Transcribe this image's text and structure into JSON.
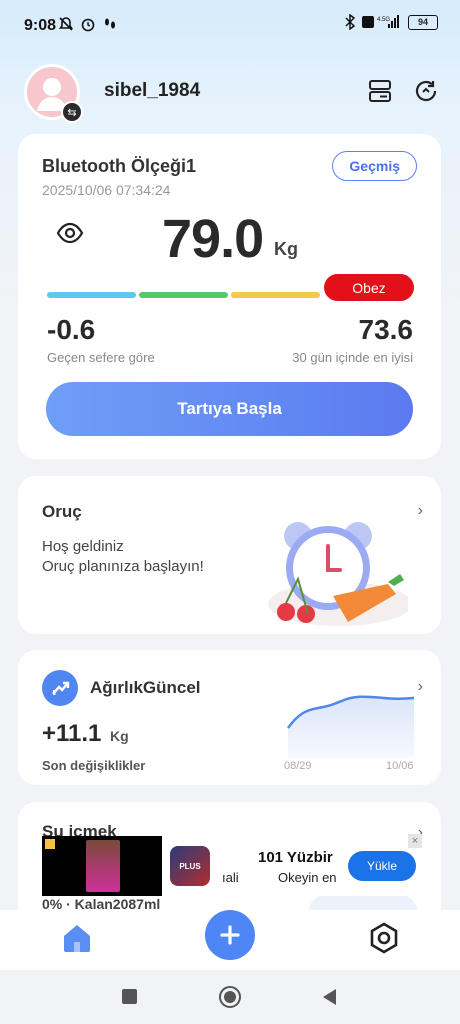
{
  "status_bar": {
    "time": "9:08",
    "battery": "94",
    "network": "4.5G"
  },
  "profile": {
    "username": "sibel_1984"
  },
  "scale_card": {
    "title": "Bluetooth Ölçeği1",
    "datetime": "2025/10/06 07:34:24",
    "history_label": "Geçmiş",
    "weight": "79.0",
    "unit": "Kg",
    "bmi_label": "Obez",
    "change_value": "-0.6",
    "change_label": "Geçen sefere göre",
    "best_value": "73.6",
    "best_label": "30 gün içinde en iyisi",
    "start_button": "Tartıya Başla"
  },
  "fasting_card": {
    "title": "Oruç",
    "line1": "Hoş geldiniz",
    "line2": "Oruç planınıza başlayın!"
  },
  "weight_card": {
    "title": "AğırlıkGüncel",
    "value": "+11.1",
    "unit": "Kg",
    "label": "Son değişiklikler",
    "date_start": "08/29",
    "date_end": "10/06"
  },
  "water_card": {
    "title": "Su içmek",
    "bottom_text": "0% · Kalan2087ml"
  },
  "ad": {
    "cut_text": "ıali",
    "title": "101 Yüzbir",
    "subtitle": "Okeyin en",
    "button": "Yükle",
    "app_icon_text": "PLUS"
  },
  "colors": {
    "accent": "#4e86f5",
    "bar_blue": "#5ec8ef",
    "bar_green": "#58c96a",
    "bar_yellow": "#f5c84c",
    "obese_red": "#e3101a"
  }
}
